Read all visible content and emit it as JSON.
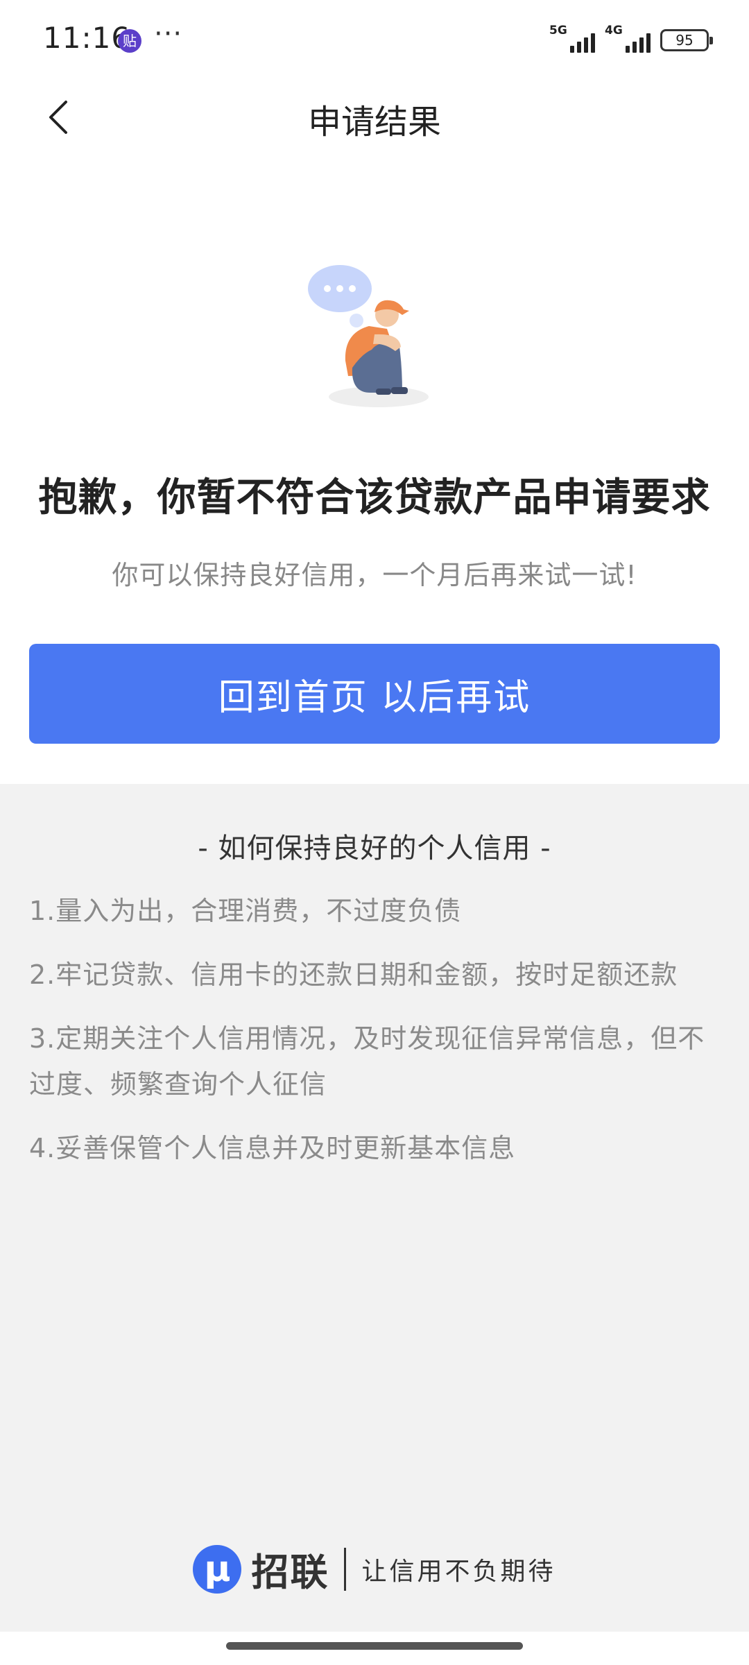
{
  "status_bar": {
    "time": "11:16",
    "app_icon_text": "贴",
    "more": "···",
    "network_1": "5G",
    "network_2": "4G",
    "battery": "95"
  },
  "nav": {
    "title": "申请结果",
    "back_icon": "chevron-left-icon"
  },
  "result": {
    "title": "抱歉，你暂不符合该贷款产品申请要求",
    "subtitle": "你可以保持良好信用，一个月后再来试一试!",
    "button_label": "回到首页 以后再试"
  },
  "tips": {
    "heading": "- 如何保持良好的个人信用 -",
    "items": [
      "1.量入为出，合理消费，不过度负债",
      "2.牢记贷款、信用卡的还款日期和金额，按时足额还款",
      "3.定期关注个人信用情况，及时发现征信异常信息，但不过度、频繁查询个人征信",
      "4.妥善保管个人信息并及时更新基本信息"
    ]
  },
  "footer": {
    "logo_glyph": "μ",
    "brand_name": "招联",
    "slogan": "让信用不负期待"
  },
  "colors": {
    "primary": "#4a78f2",
    "panel_bg": "#f2f2f2",
    "muted_text": "#888888"
  }
}
